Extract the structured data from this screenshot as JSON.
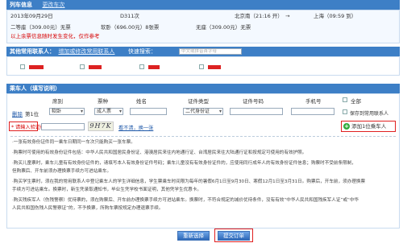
{
  "train": {
    "section_title": "列车信息",
    "change_link": "更改车次",
    "date": "2013年09月29日",
    "train_no": "D311次",
    "from": "北京南（21:16 开）",
    "to": "上海（09:59 到）",
    "arrow": "→",
    "seat1": "二等座（309.00元）无票",
    "seat2": "软卧（696.00元）8张票",
    "seat3": "无座（309.00元）无票",
    "notice": "以上余票信息随时发生变化，仅作参考"
  },
  "contacts": {
    "section_title": "其他常用联系人：",
    "manage_link": "增加或修改常用联系人",
    "search_label": "快速搜索：",
    "search_placeholder": "中文或拼音首字母"
  },
  "passengers": {
    "section_title": "乘车人（填写说明）",
    "headers": [
      "席别",
      "票种",
      "姓名",
      "证件类型",
      "证件号码",
      "手机号",
      "全部"
    ],
    "row": {
      "delete": "删除",
      "index": "第1位",
      "seat": "软卧",
      "ticket_type": "成人票",
      "id_type": "二代身份证",
      "save_label": "保存到常用联系人"
    },
    "captcha_label": "* 请输入验证码：",
    "captcha_image_text": "9H7K",
    "captcha_refresh": "看不清，换一张",
    "add_passenger": "添加1位乘车人",
    "add_icon_glyph": "+"
  },
  "notes": [
    "·一张有效身份证件同一乘车日期同一车次只能购买一张车票。",
    "·购票时可使用的有效身份证件包括：中华人民共和国居民身份证、港澳居民来往内地通行证、台湾居民来往大陆通行证和按规定可使用的有效护照。",
    "·购买儿童票时，乘车儿童有有效身份证件的，请填写本人有效身份证件号码；乘车儿童没有有效身份证件的，应使用同行成年人的有效身份证件信息；购票时不受前条限制，",
    "  但购票后、开车前须办理换票手续方可进站乘车。",
    "·购买学生票时，须在我的常用联系人中登记乘车人的学生详细信息，学生票乘车时间限为每年的暑假6月1日至9月30日、寒假12月1日至3月31日。购票后，开车前，须办理换票",
    "  手续方可进站乘车。换票时，新生凭录取通知书，毕业生凭学校书面证明，其他凭学生优惠卡。",
    "·购买残疾军人（伤残警察）优待票的，须在购票后、开车前办理换票手续方可进站乘车。换票时，不符合规定的减价优待条件，没有有效“中华人民共和国残疾军人证”或“中华",
    "  人民共和国伤残人民警察证”的，不予换票，所购车票按规定办理退票手续。"
  ],
  "buttons": {
    "reselect": "重新选择",
    "submit": "提交订单"
  },
  "colors": {
    "header_blue": "#3d7fc6",
    "accent_red": "#e02020",
    "link_blue": "#1d57a8",
    "add_green": "#2eaa3a"
  }
}
